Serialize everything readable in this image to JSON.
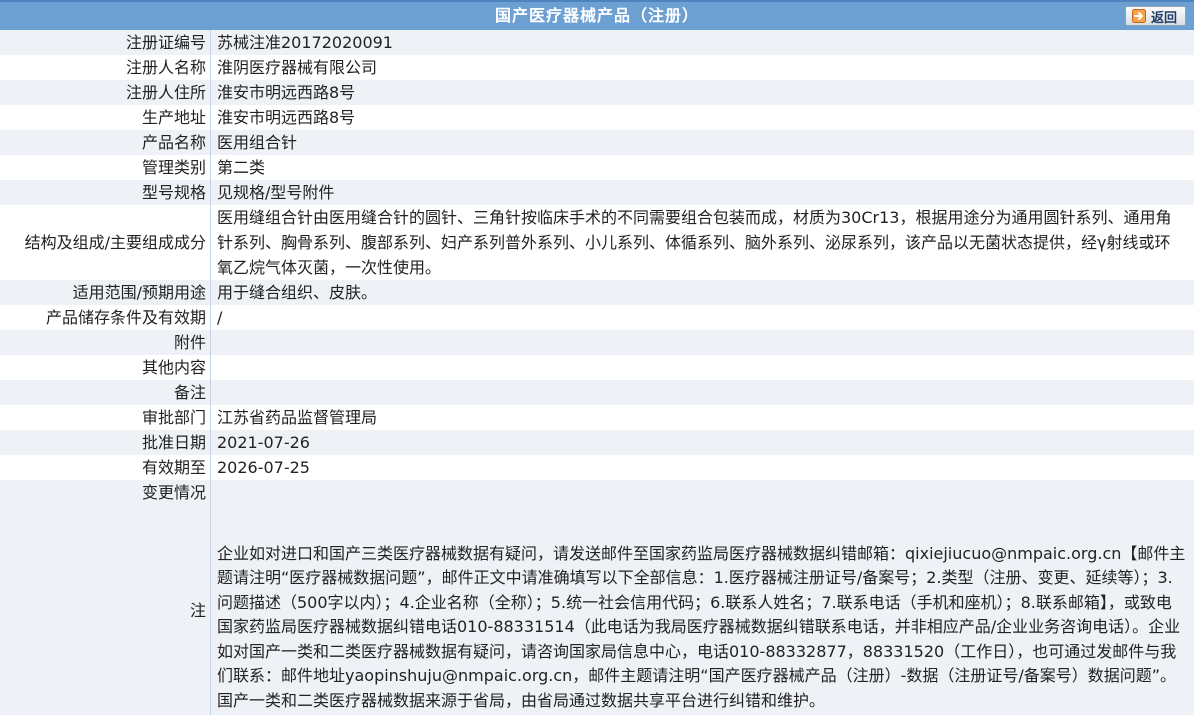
{
  "header": {
    "title": "国产医疗器械产品（注册）",
    "back_label": "返回"
  },
  "rows": [
    {
      "label": "注册证编号",
      "value": "苏械注准20172020091"
    },
    {
      "label": "注册人名称",
      "value": "淮阴医疗器械有限公司"
    },
    {
      "label": "注册人住所",
      "value": "淮安市明远西路8号"
    },
    {
      "label": "生产地址",
      "value": "淮安市明远西路8号"
    },
    {
      "label": "产品名称",
      "value": "医用组合针"
    },
    {
      "label": "管理类别",
      "value": "第二类"
    },
    {
      "label": "型号规格",
      "value": "见规格/型号附件"
    },
    {
      "label": "结构及组成/主要组成成分",
      "value": "医用缝组合针由医用缝合针的圆针、三角针按临床手术的不同需要组合包装而成，材质为30Cr13，根据用途分为通用圆针系列、通用角针系列、胸骨系列、腹部系列、妇产系列普外系列、小儿系列、体循系列、脑外系列、泌尿系列，该产品以无菌状态提供，经γ射线或环氧乙烷气体灭菌，一次性使用。"
    },
    {
      "label": "适用范围/预期用途",
      "value": "用于缝合组织、皮肤。"
    },
    {
      "label": "产品储存条件及有效期",
      "value": "/"
    },
    {
      "label": "附件",
      "value": ""
    },
    {
      "label": "其他内容",
      "value": ""
    },
    {
      "label": "备注",
      "value": ""
    },
    {
      "label": "审批部门",
      "value": "江苏省药品监督管理局"
    },
    {
      "label": "批准日期",
      "value": "2021-07-26"
    },
    {
      "label": "有效期至",
      "value": "2026-07-25"
    }
  ],
  "change": {
    "label": "变更情况"
  },
  "note": {
    "label": "注",
    "value": "企业如对进口和国产三类医疗器械数据有疑问，请发送邮件至国家药监局医疗器械数据纠错邮箱：qixiejiucuo@nmpaic.org.cn【邮件主题请注明“医疗器械数据问题”，邮件正文中请准确填写以下全部信息：1.医疗器械注册证号/备案号；2.类型（注册、变更、延续等）；3.问题描述（500字以内）；4.企业名称（全称）；5.统一社会信用代码；6.联系人姓名；7.联系电话（手机和座机）；8.联系邮箱】，或致电国家药监局医疗器械数据纠错电话010-88331514（此电话为我局医疗器械数据纠错联系电话，并非相应产品/企业业务咨询电话）。企业如对国产一类和二类医疗器械数据有疑问，请咨询国家局信息中心，电话010-88332877，88331520（工作日），也可通过发邮件与我们联系：邮件地址yaopinshuju@nmpaic.org.cn，邮件主题请注明“国产医疗器械产品（注册）-数据（注册证号/备案号）数据问题”。国产一类和二类医疗器械数据来源于省局，由省局通过数据共享平台进行纠错和维护。"
  },
  "colors": {
    "header_bg": "#6c9fd2",
    "row_odd": "#eef1f6",
    "row_even": "#ffffff",
    "back_arrow": "#e8701a"
  },
  "icons": {
    "back": "arrow-right-icon"
  }
}
